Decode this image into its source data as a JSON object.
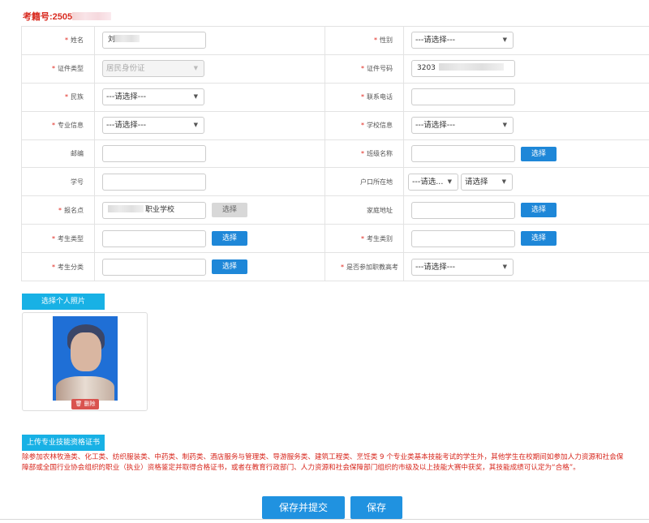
{
  "header": {
    "exam_label": "考籍号:2505"
  },
  "rows": [
    {
      "left": {
        "label": "姓名",
        "required": true,
        "value": "刘"
      },
      "right": {
        "label": "性别",
        "required": true,
        "select": "---请选择---"
      }
    },
    {
      "left": {
        "label": "证件类型",
        "required": true,
        "select": "居民身份证",
        "disabled": true
      },
      "right": {
        "label": "证件号码",
        "required": true,
        "value": "3203"
      }
    },
    {
      "left": {
        "label": "民族",
        "required": true,
        "select": "---请选择---"
      },
      "right": {
        "label": "联系电话",
        "required": true,
        "value": ""
      }
    },
    {
      "left": {
        "label": "专业信息",
        "required": true,
        "select": "---请选择---"
      },
      "right": {
        "label": "学校信息",
        "required": true,
        "select": "---请选择---"
      }
    },
    {
      "left": {
        "label": "邮编",
        "required": false,
        "value": ""
      },
      "right": {
        "label": "班级名称",
        "required": true,
        "value": "",
        "button": "选择"
      }
    },
    {
      "left": {
        "label": "学号",
        "required": false,
        "value": ""
      },
      "right": {
        "label": "户口所在地",
        "required": false,
        "select1": "---请选...",
        "select2": "请选择"
      }
    },
    {
      "left": {
        "label": "报名点",
        "required": true,
        "value": "职业学校",
        "button": "选择"
      },
      "right": {
        "label": "家庭地址",
        "required": false,
        "value": "",
        "button": "选择"
      }
    },
    {
      "left": {
        "label": "考生类型",
        "required": true,
        "value": "",
        "button": "选择"
      },
      "right": {
        "label": "考生类别",
        "required": true,
        "value": "",
        "button": "选择"
      }
    },
    {
      "left": {
        "label": "考生分类",
        "required": true,
        "value": "",
        "button": "选择"
      },
      "right": {
        "label": "是否参加职教高考",
        "required": true,
        "select": "---请选择---"
      }
    }
  ],
  "required_mark": "*",
  "photo": {
    "select_label": "选择个人照片",
    "delete_label": "删除",
    "delete_icon": "trash-icon"
  },
  "certificate": {
    "upload_label": "上传专业技能资格证书"
  },
  "notice": "除参加农林牧渔类、化工类、纺织服装类、中药类、制药类、酒店服务与管理类、导游服务类、建筑工程类、烹饪类 9 个专业类基本技能考试的学生外，其他学生在校期间如参加人力资源和社会保障部或全国行业协会组织的职业（执业）资格鉴定并取得合格证书，或者在教育行政部门、人力资源和社会保障部门组织的市级及以上技能大赛中获奖，其技能成绩可认定为“合格”。",
  "actions": {
    "submit_label": "保存并提交",
    "save_label": "保存"
  },
  "colors": {
    "accent": "#1e87d8",
    "required": "#e0261c",
    "notice": "#d7261c",
    "light_button": "#18b1e5",
    "delete": "#d9534f"
  }
}
